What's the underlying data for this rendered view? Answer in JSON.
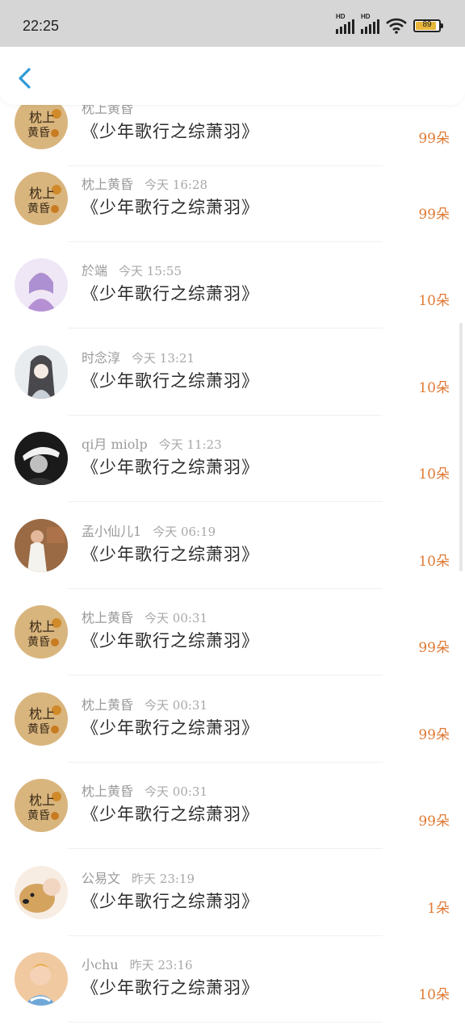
{
  "status": {
    "time": "22:25",
    "battery": "89",
    "hd1": "HD",
    "hd2": "HD"
  },
  "rows": [
    {
      "user": "枕上黄昏",
      "time": "",
      "title": "《少年歌行之综萧羽》",
      "count": "99朵",
      "avatar": "calligraphy"
    },
    {
      "user": "枕上黄昏",
      "time": "今天 16:28",
      "title": "《少年歌行之综萧羽》",
      "count": "99朵",
      "avatar": "calligraphy"
    },
    {
      "user": "於端",
      "time": "今天 15:55",
      "title": "《少年歌行之综萧羽》",
      "count": "10朵",
      "avatar": "purple-girl"
    },
    {
      "user": "时念淳",
      "time": "今天 13:21",
      "title": "《少年歌行之综萧羽》",
      "count": "10朵",
      "avatar": "dark-hair"
    },
    {
      "user": "qi月 miolp",
      "time": "今天 11:23",
      "title": "《少年歌行之综萧羽》",
      "count": "10朵",
      "avatar": "bw-cap"
    },
    {
      "user": "孟小仙儿1",
      "time": "今天 06:19",
      "title": "《少年歌行之综萧羽》",
      "count": "10朵",
      "avatar": "person-room"
    },
    {
      "user": "枕上黄昏",
      "time": "今天 00:31",
      "title": "《少年歌行之综萧羽》",
      "count": "99朵",
      "avatar": "calligraphy"
    },
    {
      "user": "枕上黄昏",
      "time": "今天 00:31",
      "title": "《少年歌行之综萧羽》",
      "count": "99朵",
      "avatar": "calligraphy"
    },
    {
      "user": "枕上黄昏",
      "time": "今天 00:31",
      "title": "《少年歌行之综萧羽》",
      "count": "99朵",
      "avatar": "calligraphy"
    },
    {
      "user": "公易文",
      "time": "昨天 23:19",
      "title": "《少年歌行之综萧羽》",
      "count": "1朵",
      "avatar": "dog"
    },
    {
      "user": "小chu",
      "time": "昨天 23:16",
      "title": "《少年歌行之综萧羽》",
      "count": "10朵",
      "avatar": "cartoon"
    }
  ]
}
